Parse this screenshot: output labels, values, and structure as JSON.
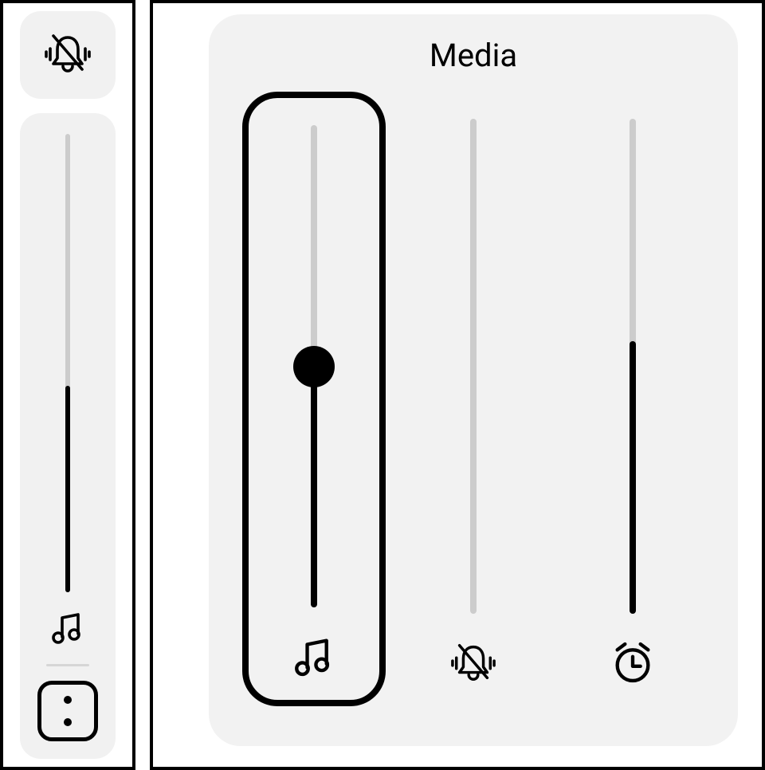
{
  "compact": {
    "top_button_icon": "bell-slash-icon",
    "slider": {
      "level_percent": 45,
      "icon": "music-note-icon"
    },
    "expand_icon": "more-icon"
  },
  "panel": {
    "title": "Media",
    "sliders": [
      {
        "id": "media",
        "icon": "music-note-icon",
        "level_percent": 50,
        "selected": true,
        "show_thumb": true
      },
      {
        "id": "ring",
        "icon": "bell-slash-icon",
        "level_percent": 0,
        "selected": false,
        "show_thumb": false
      },
      {
        "id": "alarm",
        "icon": "alarm-clock-icon",
        "level_percent": 55,
        "selected": false,
        "show_thumb": false
      }
    ]
  }
}
